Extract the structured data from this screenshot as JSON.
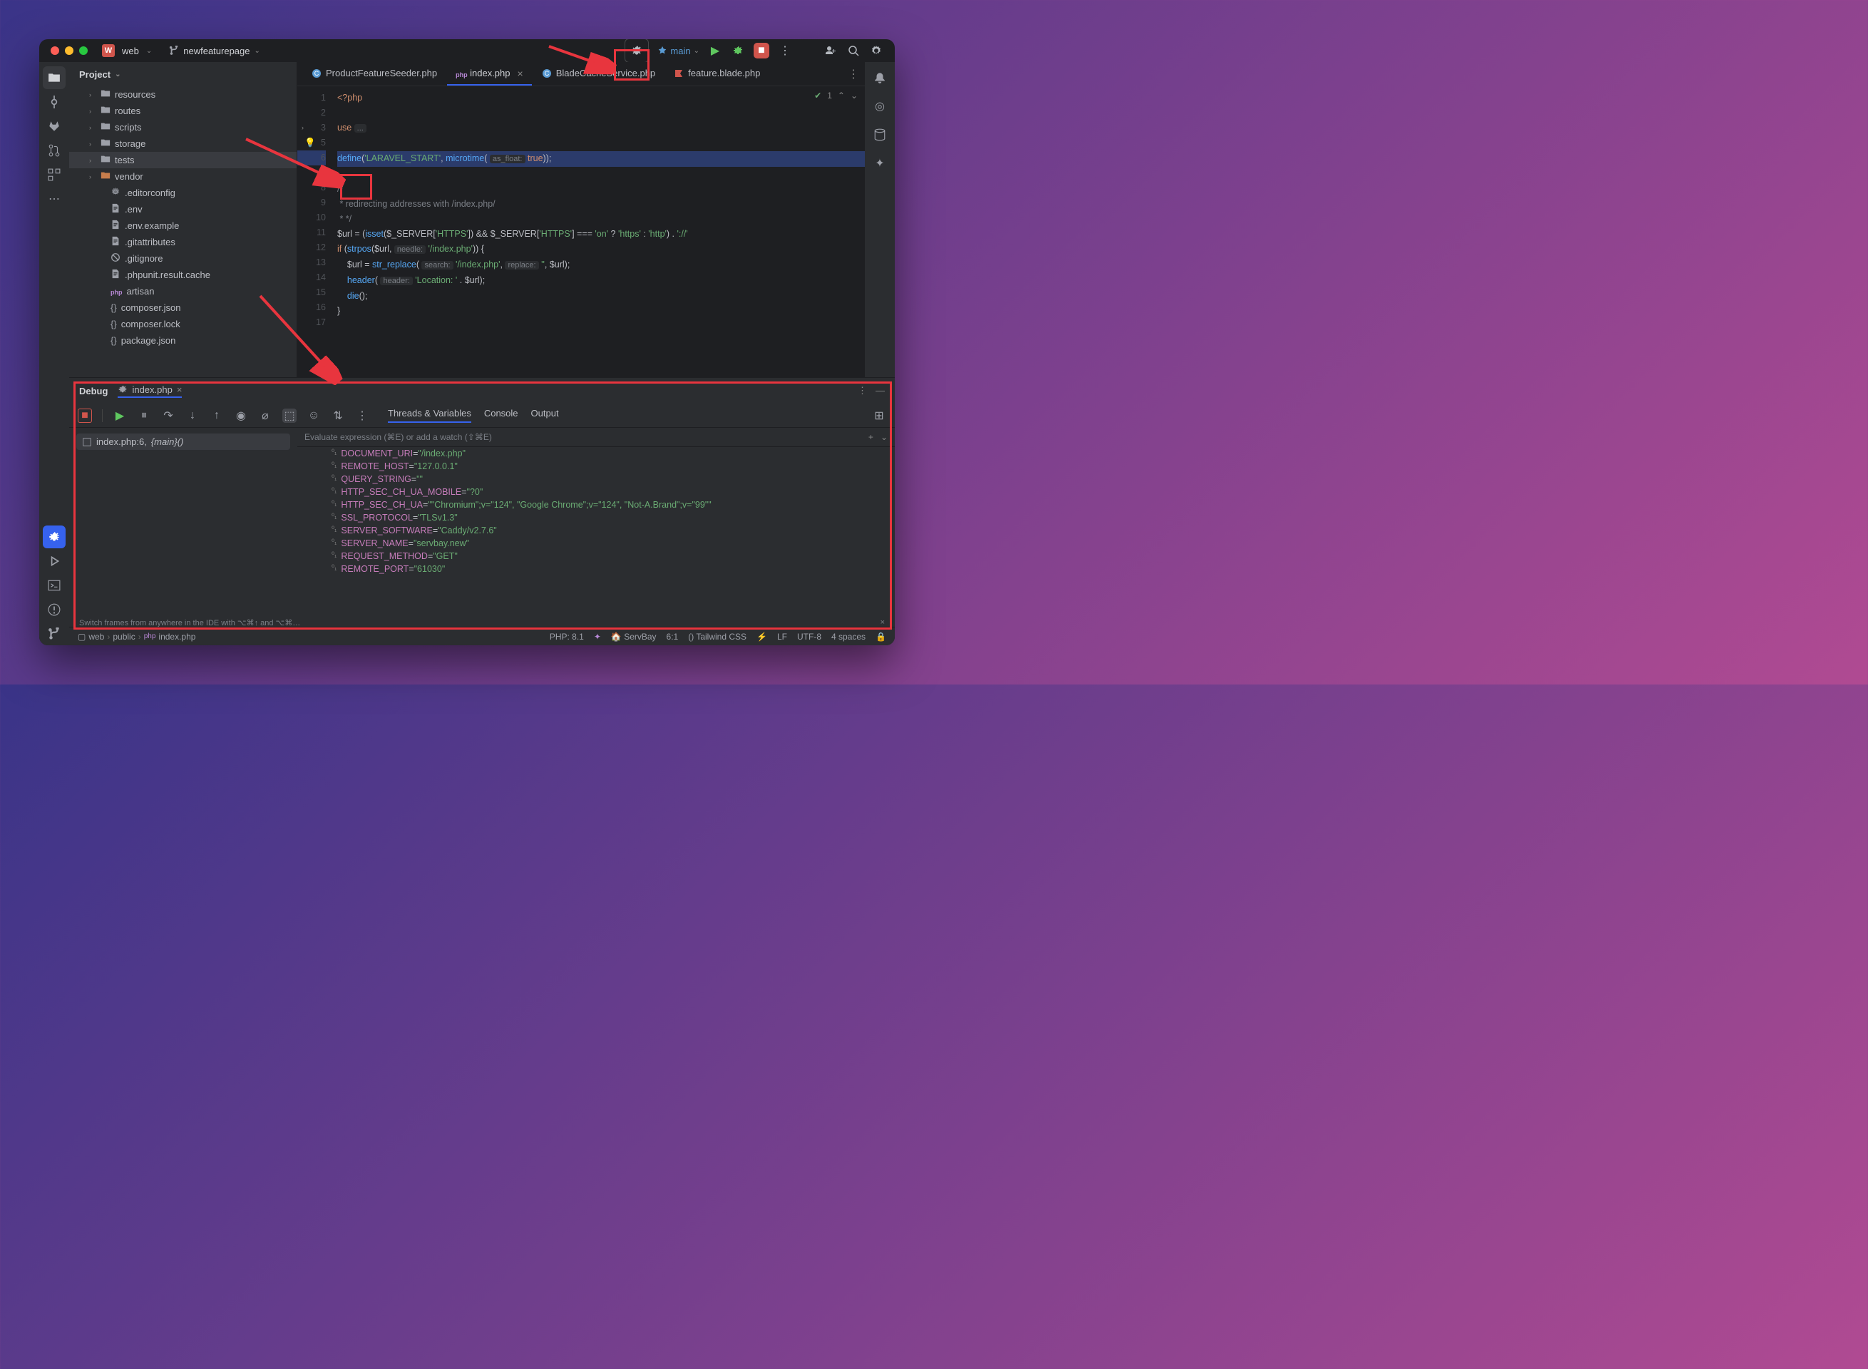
{
  "titlebar": {
    "project_badge": "W",
    "project_name": "web",
    "branch": "newfeaturepage",
    "run_config": "main"
  },
  "project": {
    "header": "Project",
    "tree": [
      {
        "name": "resources",
        "type": "folder",
        "depth": 0,
        "arrow": true
      },
      {
        "name": "routes",
        "type": "folder",
        "depth": 0,
        "arrow": true
      },
      {
        "name": "scripts",
        "type": "folder",
        "depth": 0,
        "arrow": true
      },
      {
        "name": "storage",
        "type": "folder",
        "depth": 0,
        "arrow": true
      },
      {
        "name": "tests",
        "type": "folder",
        "depth": 0,
        "arrow": true,
        "selected": true
      },
      {
        "name": "vendor",
        "type": "folder-lib",
        "depth": 0,
        "arrow": true
      },
      {
        "name": ".editorconfig",
        "type": "gear",
        "depth": 1
      },
      {
        "name": ".env",
        "type": "txt",
        "depth": 1
      },
      {
        "name": ".env.example",
        "type": "txt",
        "depth": 1
      },
      {
        "name": ".gitattributes",
        "type": "txt",
        "depth": 1
      },
      {
        "name": ".gitignore",
        "type": "git",
        "depth": 1
      },
      {
        "name": ".phpunit.result.cache",
        "type": "txt",
        "depth": 1
      },
      {
        "name": "artisan",
        "type": "php",
        "depth": 1
      },
      {
        "name": "composer.json",
        "type": "json",
        "depth": 1
      },
      {
        "name": "composer.lock",
        "type": "json",
        "depth": 1
      },
      {
        "name": "package.json",
        "type": "json",
        "depth": 1
      }
    ]
  },
  "tabs": [
    {
      "label": "ProductFeatureSeeder.php",
      "icon": "php-class",
      "active": false
    },
    {
      "label": "index.php",
      "icon": "php",
      "active": true,
      "close": true
    },
    {
      "label": "BladeCacheService.php",
      "icon": "php-class",
      "active": false
    },
    {
      "label": "feature.blade.php",
      "icon": "blade",
      "active": false
    }
  ],
  "editor": {
    "check_count": "1",
    "lines": [
      {
        "n": 1,
        "html": "<span class='k'>&lt;?php</span>"
      },
      {
        "n": 2,
        "html": ""
      },
      {
        "n": 3,
        "html": "<span class='k'>use</span> <span class='h'>...</span>",
        "fold": true
      },
      {
        "n": 5,
        "html": "",
        "bulb": true
      },
      {
        "n": 6,
        "html": "<span class='f'>define</span>(<span class='s'>'LARAVEL_START'</span>, <span class='f'>microtime</span>( <span class='h'>as_float:</span> <span class='k'>true</span>));",
        "bp": true
      },
      {
        "n": 7,
        "html": ""
      },
      {
        "n": 8,
        "html": "<span class='c'>/*</span>"
      },
      {
        "n": 9,
        "html": "<span class='c'> * redirecting addresses with /index.php/</span>"
      },
      {
        "n": 10,
        "html": "<span class='c'> * */</span>"
      },
      {
        "n": 11,
        "html": "<span class='v'>$url</span> = (<span class='f'>isset</span>(<span class='v'>$_SERVER</span>[<span class='s'>'HTTPS'</span>]) &amp;&amp; <span class='v'>$_SERVER</span>[<span class='s'>'HTTPS'</span>] === <span class='s'>'on'</span> ? <span class='s'>'https'</span> : <span class='s'>'http'</span>) . <span class='s'>'://'</span>"
      },
      {
        "n": 12,
        "html": "<span class='k'>if</span> (<span class='f'>strpos</span>(<span class='v'>$url</span>, <span class='h'>needle:</span> <span class='s'>'/index.php'</span>)) {"
      },
      {
        "n": 13,
        "html": "    <span class='v'>$url</span> = <span class='f'>str_replace</span>( <span class='h'>search:</span> <span class='s'>'/index.php'</span>, <span class='h'>replace:</span> <span class='s'>''</span>, <span class='v'>$url</span>);"
      },
      {
        "n": 14,
        "html": "    <span class='f'>header</span>( <span class='h'>header:</span> <span class='s'>'Location: '</span> . <span class='v'>$url</span>);"
      },
      {
        "n": 15,
        "html": "    <span class='f'>die</span>();"
      },
      {
        "n": 16,
        "html": "}"
      },
      {
        "n": 17,
        "html": ""
      }
    ]
  },
  "debug": {
    "title": "Debug",
    "tab": "index.php",
    "tabs": [
      "Threads & Variables",
      "Console",
      "Output"
    ],
    "frame": {
      "file": "index.php:6,",
      "fn": "{main}()"
    },
    "eval_placeholder": "Evaluate expression (⌘E) or add a watch (⇧⌘E)",
    "vars": [
      {
        "name": "DOCUMENT_URI",
        "value": "\"/index.php\""
      },
      {
        "name": "REMOTE_HOST",
        "value": "\"127.0.0.1\""
      },
      {
        "name": "QUERY_STRING",
        "value": "\"\""
      },
      {
        "name": "HTTP_SEC_CH_UA_MOBILE",
        "value": "\"?0\""
      },
      {
        "name": "HTTP_SEC_CH_UA",
        "value": "\"\"Chromium\";v=\"124\", \"Google Chrome\";v=\"124\", \"Not-A.Brand\";v=\"99\"\""
      },
      {
        "name": "SSL_PROTOCOL",
        "value": "\"TLSv1.3\""
      },
      {
        "name": "SERVER_SOFTWARE",
        "value": "\"Caddy/v2.7.6\""
      },
      {
        "name": "SERVER_NAME",
        "value": "\"servbay.new\""
      },
      {
        "name": "REQUEST_METHOD",
        "value": "\"GET\""
      },
      {
        "name": "REMOTE_PORT",
        "value": "\"61030\""
      }
    ],
    "footer_tip": "Switch frames from anywhere in the IDE with ⌥⌘↑ and ⌥⌘…"
  },
  "statusbar": {
    "breadcrumbs": [
      "web",
      "public",
      "index.php"
    ],
    "php": "PHP: 8.1",
    "servbay": "ServBay",
    "pos": "6:1",
    "tw": "Tailwind CSS",
    "lf": "LF",
    "enc": "UTF-8",
    "indent": "4 spaces"
  }
}
